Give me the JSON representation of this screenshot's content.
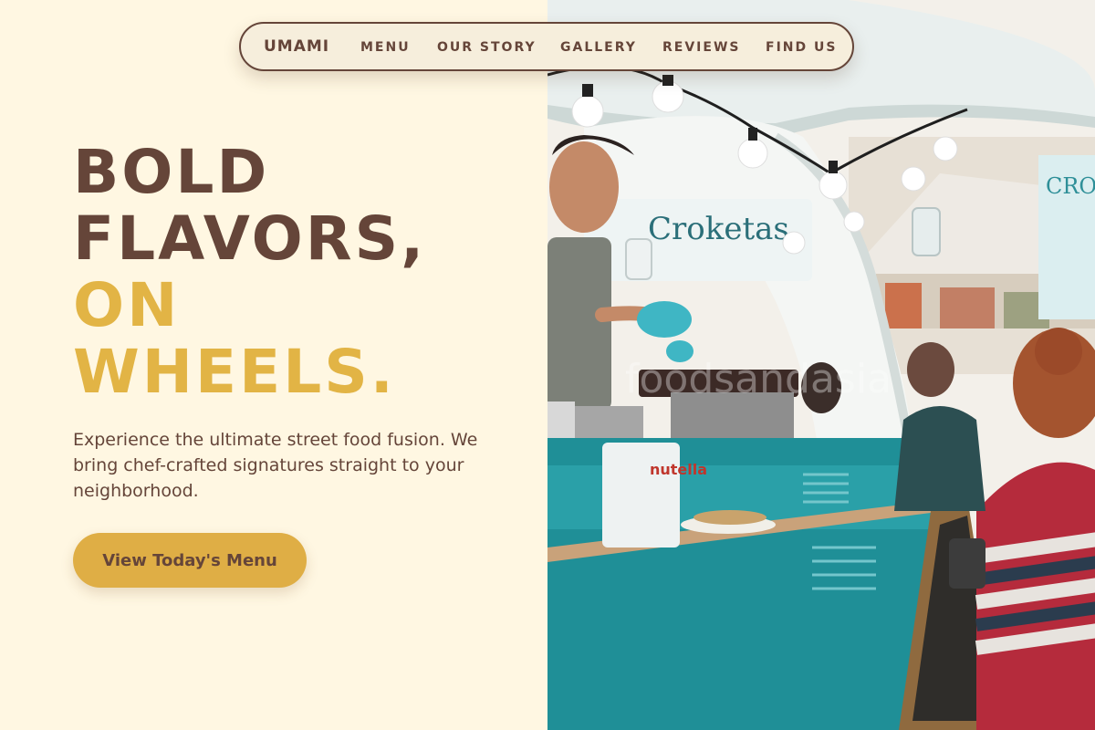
{
  "nav": {
    "logo": "UMAMI",
    "links": [
      "MENU",
      "OUR STORY",
      "GALLERY",
      "REVIEWS",
      "FIND US"
    ]
  },
  "hero": {
    "headline_lines": [
      "BOLD",
      "FLAVORS,",
      "ON",
      "WHEELS."
    ],
    "subtext": "Experience the ultimate street food fusion. We bring chef-crafted signatures straight to your neighborhood.",
    "cta_label": "View Today's Menu"
  },
  "photo": {
    "sign_text": "Croketas",
    "side_sign_text": "CRO BER FOO TRU",
    "watermark": "foodsandasia",
    "jar_label": "nutella"
  },
  "colors": {
    "background": "#FFF7E2",
    "primary_brown": "#654539",
    "accent_gold": "#E2B445",
    "teal": "#1B8D94"
  }
}
